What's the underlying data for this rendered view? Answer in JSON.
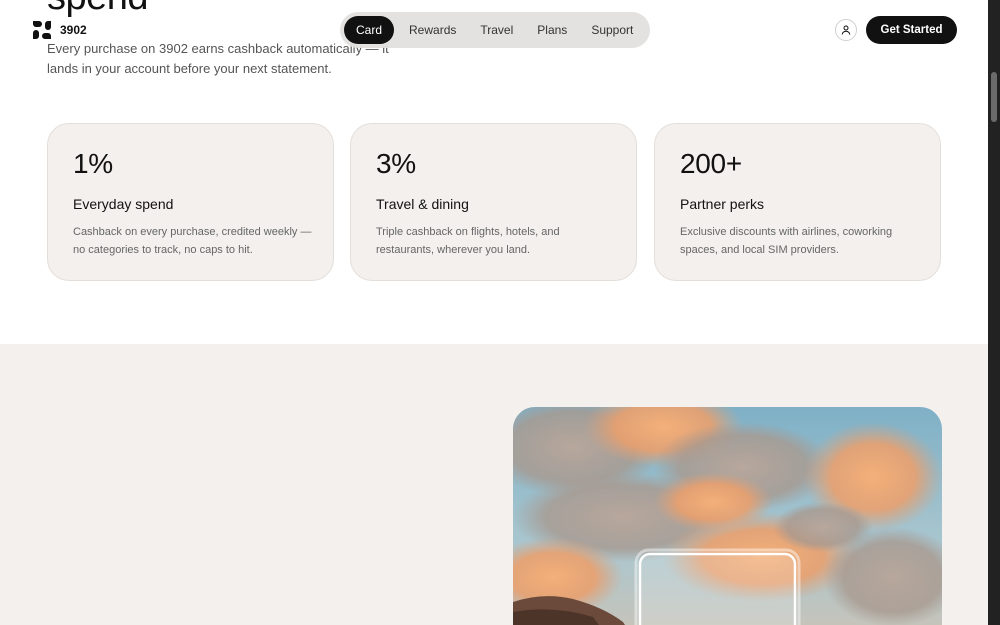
{
  "hero": {
    "big_word": "spend",
    "intro": "Every purchase on 3902 earns cashback automatically — it lands in your account before your next statement."
  },
  "brand": {
    "name": "3902",
    "logo_icon": "clover-logo-icon"
  },
  "nav": {
    "items": [
      {
        "label": "Card",
        "active": true
      },
      {
        "label": "Rewards",
        "active": false
      },
      {
        "label": "Travel",
        "active": false
      },
      {
        "label": "Plans",
        "active": false
      },
      {
        "label": "Support",
        "active": false
      }
    ]
  },
  "header": {
    "user_icon": "user-icon",
    "cta_label": "Get Started"
  },
  "cards": [
    {
      "stat": "1%",
      "title": "Everyday spend",
      "desc": "Cashback on every purchase, credited weekly — no categories to track, no caps to hit."
    },
    {
      "stat": "3%",
      "title": "Travel & dining",
      "desc": "Triple cashback on flights, hotels, and restaurants, wherever you land."
    },
    {
      "stat": "200+",
      "title": "Partner perks",
      "desc": "Exclusive discounts with airlines, coworking spaces, and local SIM providers."
    }
  ],
  "colors": {
    "card_bg": "#f3f0ed",
    "section_bg": "#f3f0ed",
    "accent_dark": "#111111",
    "nav_bg": "#e2e0de"
  }
}
